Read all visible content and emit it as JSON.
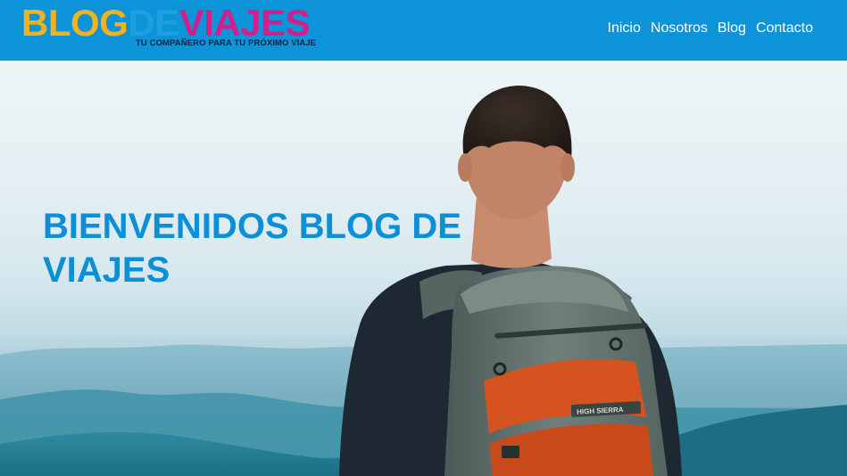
{
  "header": {
    "logo": {
      "word_blog": "BLOG",
      "word_de": "DE",
      "word_viajes": "VIAJES",
      "tagline": "TU COMPAÑERO PARA TU PRÓXIMO VIAJE"
    },
    "nav": [
      {
        "label": "Inicio"
      },
      {
        "label": "Nosotros"
      },
      {
        "label": "Blog"
      },
      {
        "label": "Contacto"
      }
    ]
  },
  "hero": {
    "title": "BIENVENIDOS BLOG DE VIAJES",
    "backpack_brand": "HIGH SIERRA"
  },
  "colors": {
    "header_bg": "#0d93d8",
    "title": "#0b8fd6",
    "logo_yellow": "#f2b21d",
    "logo_blue": "#1d9fe0",
    "logo_magenta": "#d31f8c"
  }
}
